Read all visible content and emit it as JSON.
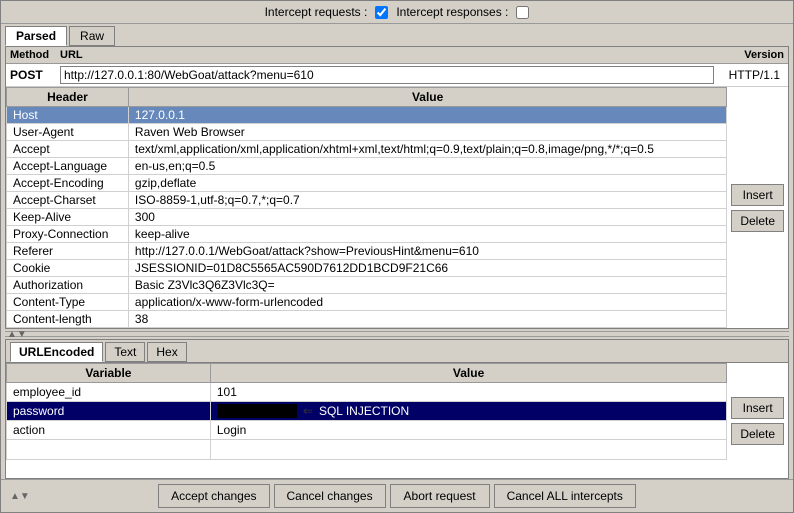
{
  "topbar": {
    "intercept_requests_label": "Intercept requests :",
    "intercept_requests_checked": true,
    "intercept_responses_label": "Intercept responses :",
    "intercept_responses_checked": false
  },
  "upper_tabs": [
    {
      "label": "Parsed",
      "active": true
    },
    {
      "label": "Raw",
      "active": false
    }
  ],
  "columns": {
    "method": "Method",
    "url": "URL",
    "version": "Version"
  },
  "request": {
    "method": "POST",
    "url": "http://127.0.0.1:80/WebGoat/attack?menu=610",
    "version": "HTTP/1.1"
  },
  "headers_table": {
    "col_header": "Header",
    "col_value": "Value",
    "rows": [
      {
        "header": "Host",
        "value": "127.0.0.1",
        "selected": true
      },
      {
        "header": "User-Agent",
        "value": "Raven Web Browser",
        "selected": false
      },
      {
        "header": "Accept",
        "value": "text/xml,application/xml,application/xhtml+xml,text/html;q=0.9,text/plain;q=0.8,image/png,*/*;q=0.5",
        "selected": false
      },
      {
        "header": "Accept-Language",
        "value": "en-us,en;q=0.5",
        "selected": false
      },
      {
        "header": "Accept-Encoding",
        "value": "gzip,deflate",
        "selected": false
      },
      {
        "header": "Accept-Charset",
        "value": "ISO-8859-1,utf-8;q=0.7,*;q=0.7",
        "selected": false
      },
      {
        "header": "Keep-Alive",
        "value": "300",
        "selected": false
      },
      {
        "header": "Proxy-Connection",
        "value": "keep-alive",
        "selected": false
      },
      {
        "header": "Referer",
        "value": "http://127.0.0.1/WebGoat/attack?show=PreviousHint&menu=610",
        "selected": false
      },
      {
        "header": "Cookie",
        "value": "JSESSIONID=01D8C5565AC590D7612DD1BCD9F21C66",
        "selected": false
      },
      {
        "header": "Authorization",
        "value": "Basic Z3Vlc3Q6Z3Vlc3Q=",
        "selected": false
      },
      {
        "header": "Content-Type",
        "value": "application/x-www-form-urlencoded",
        "selected": false
      },
      {
        "header": "Content-length",
        "value": "38",
        "selected": false
      }
    ]
  },
  "insert_btn": "Insert",
  "delete_btn": "Delete",
  "lower_tabs": [
    {
      "label": "URLEncoded",
      "active": true
    },
    {
      "label": "Text",
      "active": false
    },
    {
      "label": "Hex",
      "active": false
    }
  ],
  "params_table": {
    "col_variable": "Variable",
    "col_value": "Value",
    "rows": [
      {
        "variable": "employee_id",
        "value": "101",
        "selected": false,
        "sql_injection": false
      },
      {
        "variable": "password",
        "value": "",
        "selected": true,
        "sql_injection": true
      },
      {
        "variable": "action",
        "value": "Login",
        "selected": false,
        "sql_injection": false
      }
    ]
  },
  "sql_injection_label": "SQL INJECTION",
  "bottom_buttons": [
    {
      "label": "Accept changes",
      "name": "accept-changes-button"
    },
    {
      "label": "Cancel changes",
      "name": "cancel-changes-button"
    },
    {
      "label": "Abort request",
      "name": "abort-request-button"
    },
    {
      "label": "Cancel ALL intercepts",
      "name": "cancel-all-intercepts-button"
    }
  ]
}
